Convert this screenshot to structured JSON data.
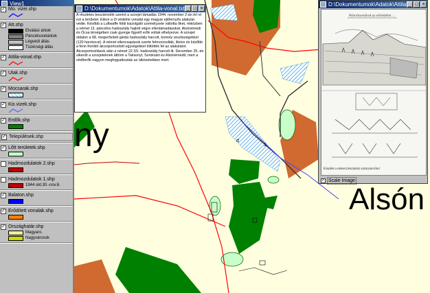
{
  "window": {
    "title": "View1"
  },
  "legend": {
    "items": [
      {
        "label": "Mo. vizei.shp",
        "checked": true
      },
      {
        "label": "Att.shp",
        "checked": true,
        "classes": [
          {
            "label": "Elválási árkok",
            "color": "#000000"
          },
          {
            "label": "Páncélsorelárkok",
            "color": "#808080"
          },
          {
            "label": "Légvédi állás",
            "color": "#c0c0c0"
          },
          {
            "label": "Tüzérségi állás",
            "color": "#ffffff"
          }
        ]
      },
      {
        "label": "Attila-vonal.shp",
        "checked": true
      },
      {
        "label": "Utak.shp",
        "checked": true
      },
      {
        "label": "Mocsarak.shp",
        "checked": true
      },
      {
        "label": "Kis vizek.shp",
        "checked": true
      },
      {
        "label": "Erdők.shp",
        "checked": true
      },
      {
        "label": "Települések.shp",
        "checked": true
      },
      {
        "label": "Lőtt területek.shp",
        "checked": true
      },
      {
        "label": "Hadmozdulatok 2.shp",
        "checked": false
      },
      {
        "label": "Hadmozdulatok 1.shp",
        "checked": false,
        "sub": "1944 okt.30.-nov.6."
      },
      {
        "label": "Balaton.shp",
        "checked": true
      },
      {
        "label": "Erődített vonalak.shp",
        "checked": true
      },
      {
        "label": "Országhatár.shp",
        "checked": true,
        "classes": [
          {
            "label": "Magyaro.",
            "color": "#e8f0a0"
          },
          {
            "label": "Nagyvárosok",
            "color": "#c8e000"
          }
        ]
      }
    ],
    "colors": {
      "mo_vizei": "#0000ff",
      "attila_vonal": "#ff0000",
      "utak": "#ff0000",
      "mocsarak": "#a0e0ff",
      "kis_vizek": "#6060ff",
      "erdok": "#008000",
      "lott": "#c8ffc8",
      "hadmozd2": "#c00000",
      "hadmozd1": "#c00000",
      "balaton": "#0000ff",
      "erodvonal": "#ff8000"
    }
  },
  "text_window": {
    "title": "D:\\Dokumentumok\\Adatok\\Attila-vonal.txt",
    "body": "A részletes beszámolók szerint a szovjet támadás 1944. november 2-án ért el ezt a területet. Ekkor a t3 védelmi vonalat egy magyar ejtőernyős alakulat védte. Később a Luftwaffe földi kiszolgáló személyzete váltotta őket, miközben a német 13. páncélos hadosztály hajtott végre ellentámadásokat. Alsónémedi és Ócsa térségében csak gyenge figyelő erők voltak elhelyezve. A szovjet oldalon a 68. megerősített gárda hadosztály harcolt, komoly veszteségekkel (120 harckocsi). A német ellencsapások szerte felmorzsolták, illetve és később a fenn fronttól átcsoportosított egységekkel töltötték fel az alakulatot. Átcsoportosítások után a német 22.SS. hadosztály harcolt itt. December 25.-én sikerült a szovjeteknek áttörni a Taksonyt, Soroksárt és Alsónémedit, mert a védőerők nagyon megfogyatkoztak az ütközetekben mert."
  },
  "image_window": {
    "title": "D:\\Dokumentumok\\Adatok\\Attila...",
    "caption_top": "Páncélsorelárok az elővédelmi …",
    "caption_bottom": "Kiszélet a német (részlarás) szárnyiarvibol",
    "scale_label": "Scale Image",
    "scale_checked": true
  },
  "map": {
    "labels": {
      "left_town": "ny",
      "right_town": "Alsón",
      "small_1": "d",
      "small_2": "1"
    },
    "colors": {
      "background": "#ffffe0",
      "forest": "#008000",
      "settlement": "#d06a30",
      "wetland_fill": "#a0e0ff",
      "light_green": "#c8ffc8",
      "road": "#ff0000",
      "railway": "#000000",
      "stream": "#4040ff"
    }
  }
}
